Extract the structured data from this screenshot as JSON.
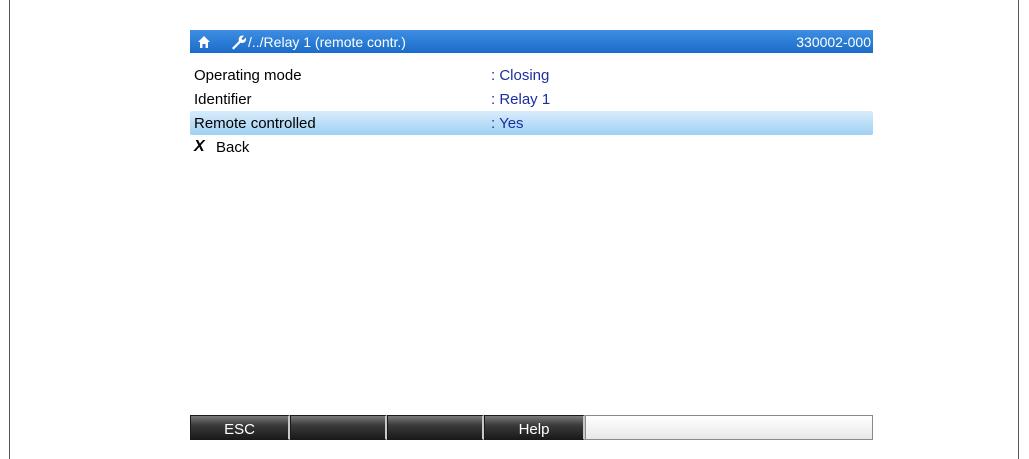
{
  "title_bar": {
    "home_icon": "home-icon",
    "wrench_icon": "wrench-icon",
    "path": "/../Relay 1 (remote contr.)",
    "code": "330002-000"
  },
  "rows": [
    {
      "label": "Operating mode",
      "value": ": Closing",
      "selected": false
    },
    {
      "label": "Identifier",
      "value": ": Relay 1",
      "selected": false
    },
    {
      "label": "Remote controlled",
      "value": ": Yes",
      "selected": true
    }
  ],
  "back": {
    "icon": "x-icon",
    "label": "Back"
  },
  "softkeys": [
    "ESC",
    "",
    "",
    "Help",
    ""
  ],
  "colors": {
    "title_bar": "#1b6cc9",
    "selection": "#9fd0f3",
    "value_text": "#1a2ea0"
  }
}
